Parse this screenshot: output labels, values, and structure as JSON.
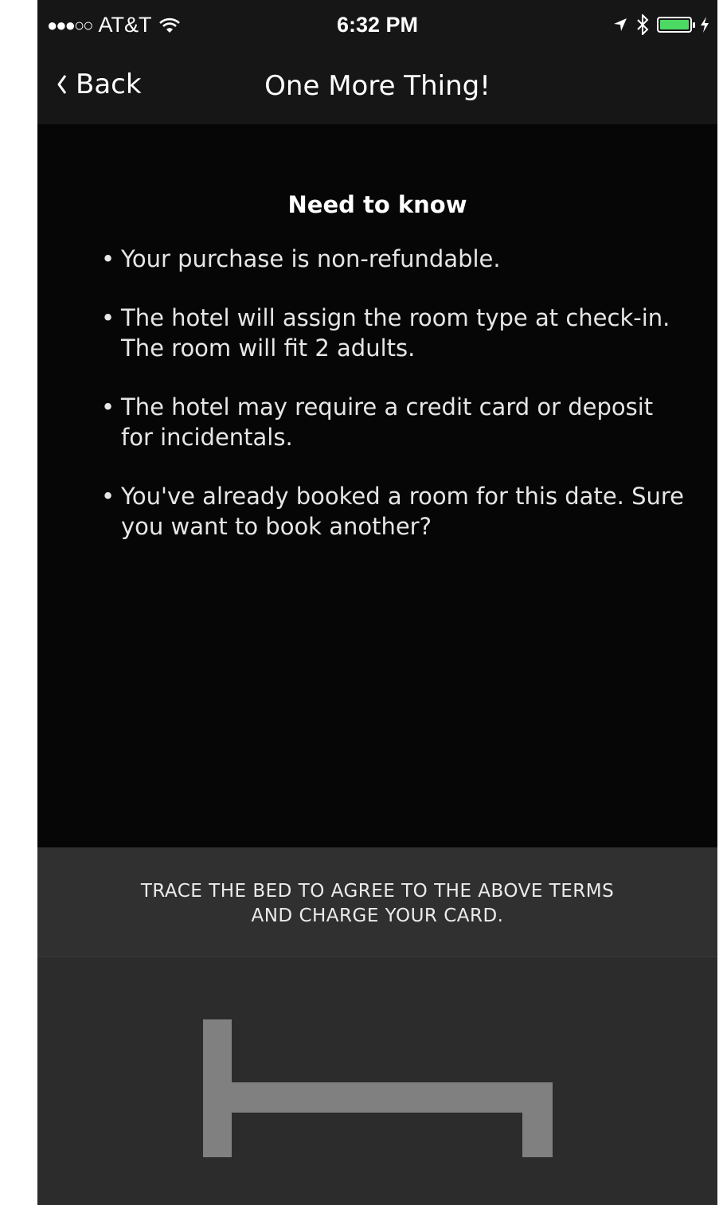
{
  "status_bar": {
    "signal": "●●●○○",
    "carrier": "AT&T",
    "time": "6:32 PM",
    "battery_level": 1.0,
    "battery_color": "#4cd964"
  },
  "nav": {
    "back_label": "Back",
    "title": "One More Thing!"
  },
  "content": {
    "heading": "Need to know",
    "bullet_char": "•",
    "items": [
      "Your purchase is non-refundable.",
      "The hotel will assign the room type at check-in. The room will fit 2 adults.",
      "The hotel may require a credit card or deposit for incidentals.",
      "You've already booked a room for this date. Sure you want to book another?"
    ]
  },
  "instruction": {
    "line1": "TRACE THE BED TO AGREE TO THE ABOVE TERMS",
    "line2": "AND CHARGE YOUR CARD."
  },
  "trace": {
    "icon": "bed-icon",
    "color": "#808080"
  }
}
